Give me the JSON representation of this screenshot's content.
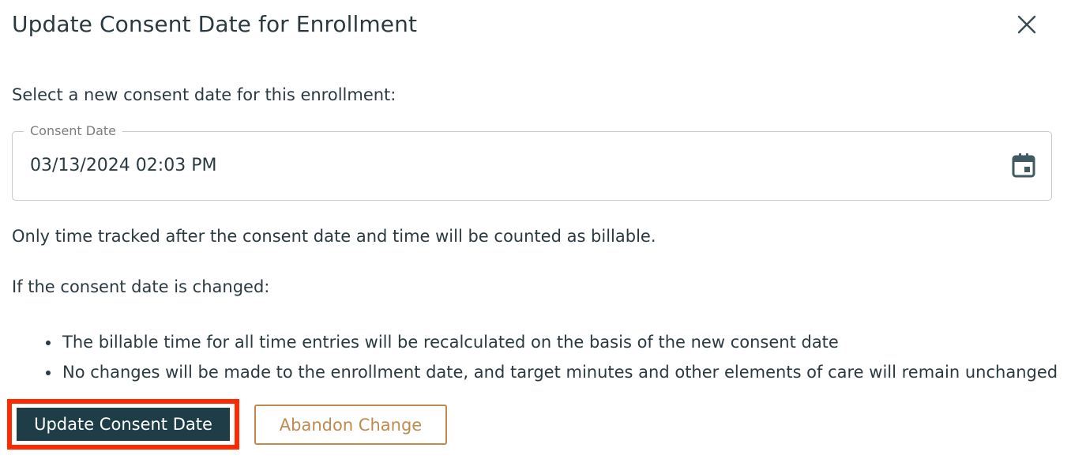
{
  "dialog": {
    "title": "Update Consent Date for Enrollment",
    "prompt": "Select a new consent date for this enrollment:",
    "consent_field": {
      "legend": "Consent Date",
      "value": "03/13/2024 02:03 PM",
      "icon": "calendar-icon"
    },
    "info": "Only time tracked after the consent date and time will be counted as billable.",
    "changed_heading": "If the consent date is changed:",
    "bullets": [
      "The billable time for all time entries will be recalculated on the basis of the new consent date",
      "No changes will be made to the enrollment date, and target minutes and other elements of care will remain unchanged"
    ],
    "buttons": {
      "update": "Update Consent Date",
      "abandon": "Abandon Change"
    },
    "close_icon": "close-icon"
  },
  "colors": {
    "primary": "#1e3d47",
    "secondary": "#c0894d",
    "highlight": "#ff2a00",
    "text": "#2b3a41"
  }
}
